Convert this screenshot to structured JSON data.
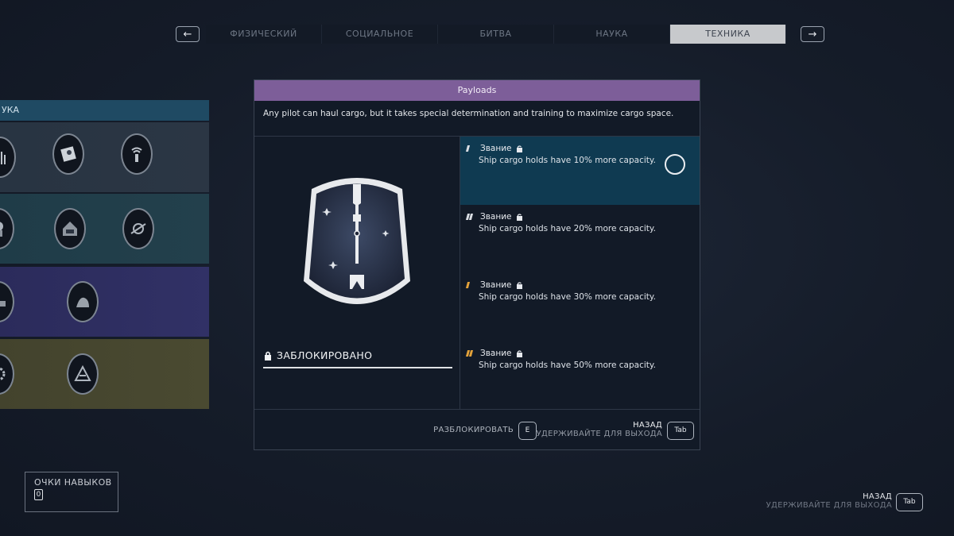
{
  "nav": {
    "prev_icon": "←",
    "next_icon": "→",
    "tabs": [
      {
        "label": "ФИЗИЧЕСКИЙ",
        "active": false
      },
      {
        "label": "СОЦИАЛЬНОЕ",
        "active": false
      },
      {
        "label": "БИТВА",
        "active": false
      },
      {
        "label": "НАУКА",
        "active": false
      },
      {
        "label": "ТЕХНИКА",
        "active": true
      }
    ]
  },
  "tree": {
    "header": "УКА",
    "row_colors": [
      "#2b3644",
      "#23404c",
      "#313166",
      "#4a4a31"
    ]
  },
  "skill": {
    "title": "Payloads",
    "description": "Any pilot can haul cargo, but it takes special determination and training to maximize cargo space.",
    "status": "ЗАБЛОКИРОВАНО",
    "ranks": [
      {
        "label": "Звание",
        "desc": "Ship cargo holds have 10% more capacity.",
        "active": true,
        "pip_color": "#d9dde3"
      },
      {
        "label": "Звание",
        "desc": "Ship cargo holds have 20% more capacity.",
        "active": false,
        "pip_color": "#d9dde3"
      },
      {
        "label": "Звание",
        "desc": "Ship cargo holds have 30% more capacity.",
        "active": false,
        "pip_color": "#e3a23a"
      },
      {
        "label": "Звание",
        "desc": "Ship cargo holds have 50% more capacity.",
        "active": false,
        "pip_color": "#e3a23a"
      }
    ]
  },
  "footer": {
    "unlock_label": "РАЗБЛОКИРОВАТЬ",
    "unlock_key": "E",
    "back_label": "НАЗАД",
    "back_hint": "УДЕРЖИВАЙТЕ ДЛЯ ВЫХОДА",
    "back_key": "Tab"
  },
  "points": {
    "label": "ОЧКИ НАВЫКОВ",
    "value": "0"
  },
  "screen_back": {
    "label": "НАЗАД",
    "hint": "УДЕРЖИВАЙТЕ ДЛЯ ВЫХОДА",
    "key": "Tab"
  },
  "colors": {
    "accent_purple": "#7d5e99",
    "active_rank_bg": "#0f3a51",
    "tree_header": "#1f4a63"
  }
}
